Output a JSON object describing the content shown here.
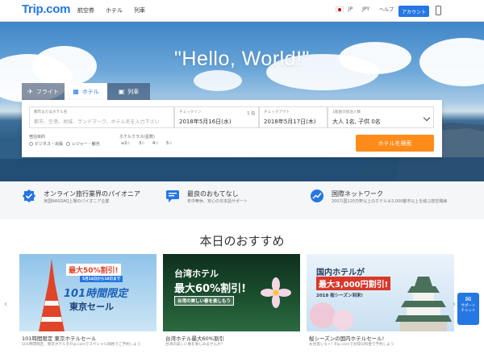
{
  "brand": {
    "logo": "Trip.com",
    "accent": "#2577e3",
    "cta": "#ff8c1a"
  },
  "nav": {
    "items": [
      "航空券",
      "ホテル",
      "列車"
    ]
  },
  "topright": {
    "lang": "JP",
    "currency": "JPY",
    "help": "ヘルプ",
    "account": "アカウント"
  },
  "hero": {
    "title": "\"Hello, World!\""
  },
  "search": {
    "tabs": [
      {
        "label": "フライト",
        "icon": "plane-icon"
      },
      {
        "label": "ホテル",
        "icon": "hotel-icon"
      },
      {
        "label": "列車",
        "icon": "train-icon"
      }
    ],
    "destination": {
      "label": "都市またはホテル名",
      "placeholder": "都市、空港、地域、ランドマーク、ホテル名を入力下さい"
    },
    "checkin": {
      "label": "チェックイン",
      "value": "2018年5月16日(水)",
      "nights": "1 泊"
    },
    "checkout": {
      "label": "チェックアウト",
      "value": "2018年5月17日(木)"
    },
    "guests": {
      "label": "1部屋の宿泊人数",
      "value": "大人 1名, 子供 0名"
    },
    "purpose_label": "宿泊目的",
    "purposes": [
      "ビジネス・出張",
      "レジャー・観光"
    ],
    "stars_label": "ホテルクラス(星数)",
    "stars": [
      "≤2☆",
      "3☆",
      "4☆",
      "5☆"
    ],
    "button": "ホテルを検索"
  },
  "features": [
    {
      "title": "オンライン旅行業界のパイオニア",
      "sub": "米国NASDAQ上場のパイオニア企業",
      "icon": "badge-check-icon"
    },
    {
      "title": "最良のおもてなし",
      "sub": "年中無休、安心の日本語サポート",
      "icon": "chat-icon"
    },
    {
      "title": "国際ネットワーク",
      "sub": "200カ国120万軒以上のホテル＆5,000都市以上を結ぶ航空路線",
      "icon": "chart-icon"
    }
  ],
  "recommend": {
    "title": "本日のおすすめ",
    "cards": [
      {
        "caption": "101時間限定 東京ホテルセール",
        "sub": "101時間限定、東京ホテルをTrip.comでスペシャル価格でご予約しよう",
        "badge1": "最大50%割引!",
        "badge2": "5月14日から18日まで",
        "badge3": "101時間限定",
        "badge4": "東京セール"
      },
      {
        "caption": "台湾ホテル最大60%割引",
        "sub": "台湾の美しい春を楽しみませんか?",
        "badge1": "台湾ホテル",
        "badge2": "最大60%割引!",
        "badge3": "台湾の美しい春を楽しもう"
      },
      {
        "caption": "桜シーズンの国内ホテルセール!",
        "sub": "お見逃しなく! Trip.comでお得な料金で予約しよう",
        "badge1": "国内ホテルが",
        "badge2": "最大3,000円割引!",
        "badge3": "2018 桜シーズン到来!"
      }
    ]
  },
  "support": {
    "label": "サポート\nチャット"
  }
}
